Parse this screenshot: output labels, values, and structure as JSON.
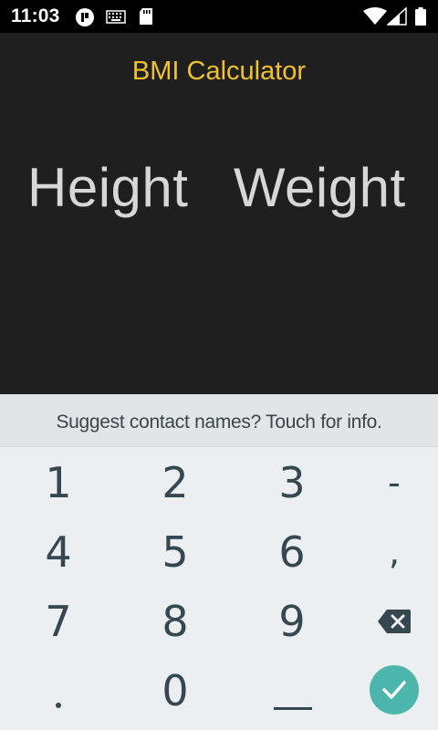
{
  "status_bar": {
    "time": "11:03",
    "icons": [
      "app-notification-icon",
      "keyboard-icon",
      "sd-card-icon",
      "wifi-icon",
      "signal-icon",
      "battery-icon"
    ]
  },
  "app": {
    "title": "BMI Calculator",
    "height_placeholder": "Height",
    "weight_placeholder": "Weight",
    "accent_color": "#f2c12e"
  },
  "keyboard": {
    "suggestion": "Suggest contact names? Touch for info.",
    "keys": {
      "k1": "1",
      "k2": "2",
      "k3": "3",
      "minus": "-",
      "k4": "4",
      "k5": "5",
      "k6": "6",
      "comma": ",",
      "k7": "7",
      "k8": "8",
      "k9": "9",
      "k0": "0"
    },
    "enter_color": "#4db6ac"
  }
}
